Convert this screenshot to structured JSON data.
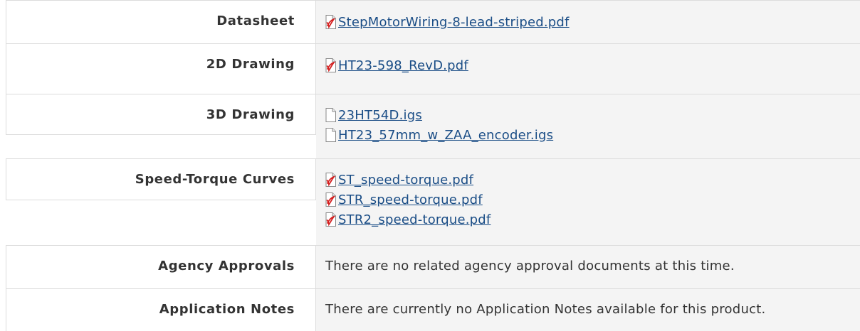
{
  "rows": [
    {
      "label": "Datasheet",
      "files": [
        {
          "name": "StepMotorWiring-8-lead-striped.pdf",
          "icon": "pdf-icon"
        }
      ]
    },
    {
      "label": "2D Drawing",
      "files": [
        {
          "name": "HT23-598_RevD.pdf",
          "icon": "pdf-icon"
        }
      ]
    },
    {
      "label": "3D Drawing",
      "files": [
        {
          "name": "23HT54D.igs",
          "icon": "document-icon"
        },
        {
          "name": "HT23_57mm_w_ZAA_encoder.igs",
          "icon": "document-icon"
        }
      ]
    },
    {
      "label": "Speed-Torque Curves",
      "files": [
        {
          "name": "ST_speed-torque.pdf",
          "icon": "pdf-icon"
        },
        {
          "name": "STR_speed-torque.pdf",
          "icon": "pdf-icon"
        },
        {
          "name": "STR2_speed-torque.pdf",
          "icon": "pdf-icon"
        }
      ]
    },
    {
      "label": "Agency Approvals",
      "text": "There are no related agency approval documents at this time."
    },
    {
      "label": "Application Notes",
      "text": "There are currently no Application Notes available for this product."
    }
  ],
  "colors": {
    "link": "#1a4d86",
    "value_background": "#f4f4f4",
    "border": "#dcdcdc",
    "pdf_icon_red": "#d42020"
  }
}
